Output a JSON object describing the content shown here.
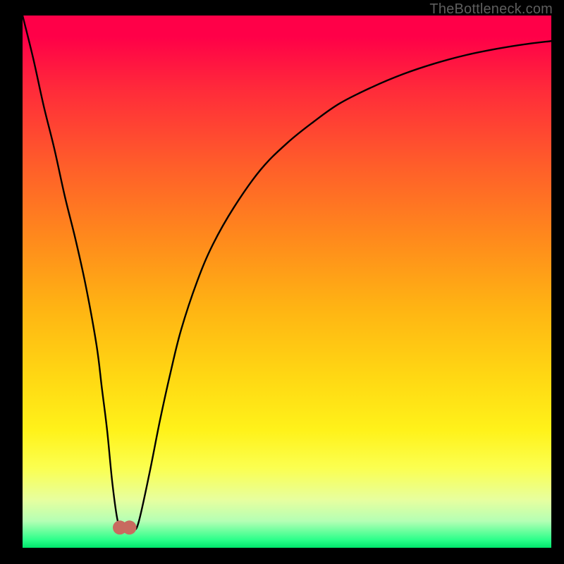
{
  "watermark": "TheBottleneck.com",
  "chart_data": {
    "type": "line",
    "title": "",
    "xlabel": "",
    "ylabel": "",
    "xlim": [
      0,
      100
    ],
    "ylim": [
      0,
      100
    ],
    "grid": false,
    "x": [
      0,
      2,
      4,
      6,
      8,
      10,
      12,
      14,
      15,
      16,
      17,
      18,
      19,
      20,
      21,
      22,
      24,
      26,
      28,
      30,
      33,
      36,
      40,
      45,
      50,
      55,
      60,
      66,
      72,
      78,
      84,
      90,
      95,
      100
    ],
    "values": [
      100,
      92,
      83,
      75,
      66,
      58,
      49,
      38,
      30,
      22,
      12,
      5,
      3.2,
      3.0,
      3.2,
      5,
      14,
      24,
      33,
      41,
      50,
      57,
      64,
      71,
      76,
      80,
      83.5,
      86.5,
      89,
      91,
      92.6,
      93.8,
      94.6,
      95.2
    ],
    "markers": {
      "x": [
        18.4,
        20.2
      ],
      "y": [
        3.8,
        3.8
      ],
      "color": "#c86a5f",
      "size": 10
    },
    "gradient_stops": [
      {
        "pos": 0.0,
        "color": "#ff0048"
      },
      {
        "pos": 0.28,
        "color": "#ff5d2a"
      },
      {
        "pos": 0.55,
        "color": "#ffb413"
      },
      {
        "pos": 0.78,
        "color": "#fff21a"
      },
      {
        "pos": 0.95,
        "color": "#b4ffb4"
      },
      {
        "pos": 1.0,
        "color": "#00e56b"
      }
    ]
  }
}
